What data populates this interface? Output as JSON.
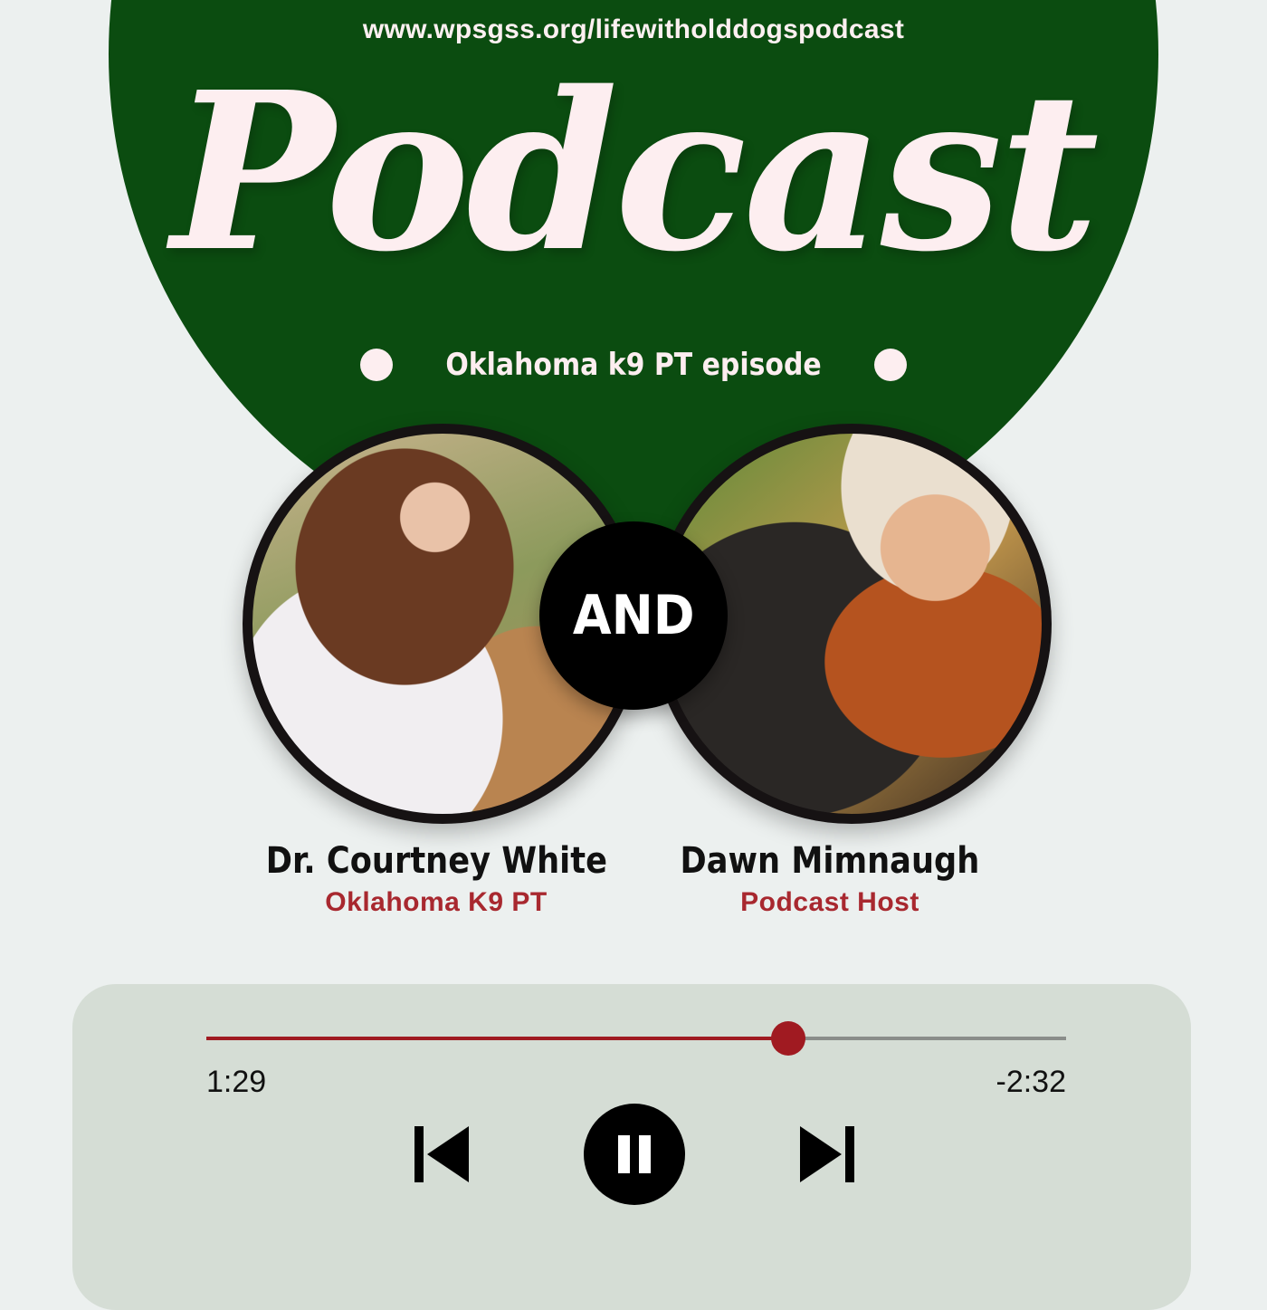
{
  "header": {
    "url": "www.wpsgss.org/lifewitholddogspodcast",
    "title": "Podcast",
    "episode": "Oklahoma k9 PT episode"
  },
  "connector": "AND",
  "guests": [
    {
      "name": "Dr. Courtney White",
      "role": "Oklahoma K9 PT"
    },
    {
      "name": "Dawn Mimnaugh",
      "role": "Podcast Host"
    }
  ],
  "player": {
    "elapsed": "1:29",
    "remaining": "-2:32",
    "progress_fraction": 0.677
  },
  "colors": {
    "brand_green": "#0b4c10",
    "accent_red": "#a01a21",
    "text_pink": "#fdeef0"
  },
  "icons": {
    "previous": "skip-previous-icon",
    "pause": "pause-icon",
    "next": "skip-next-icon"
  }
}
